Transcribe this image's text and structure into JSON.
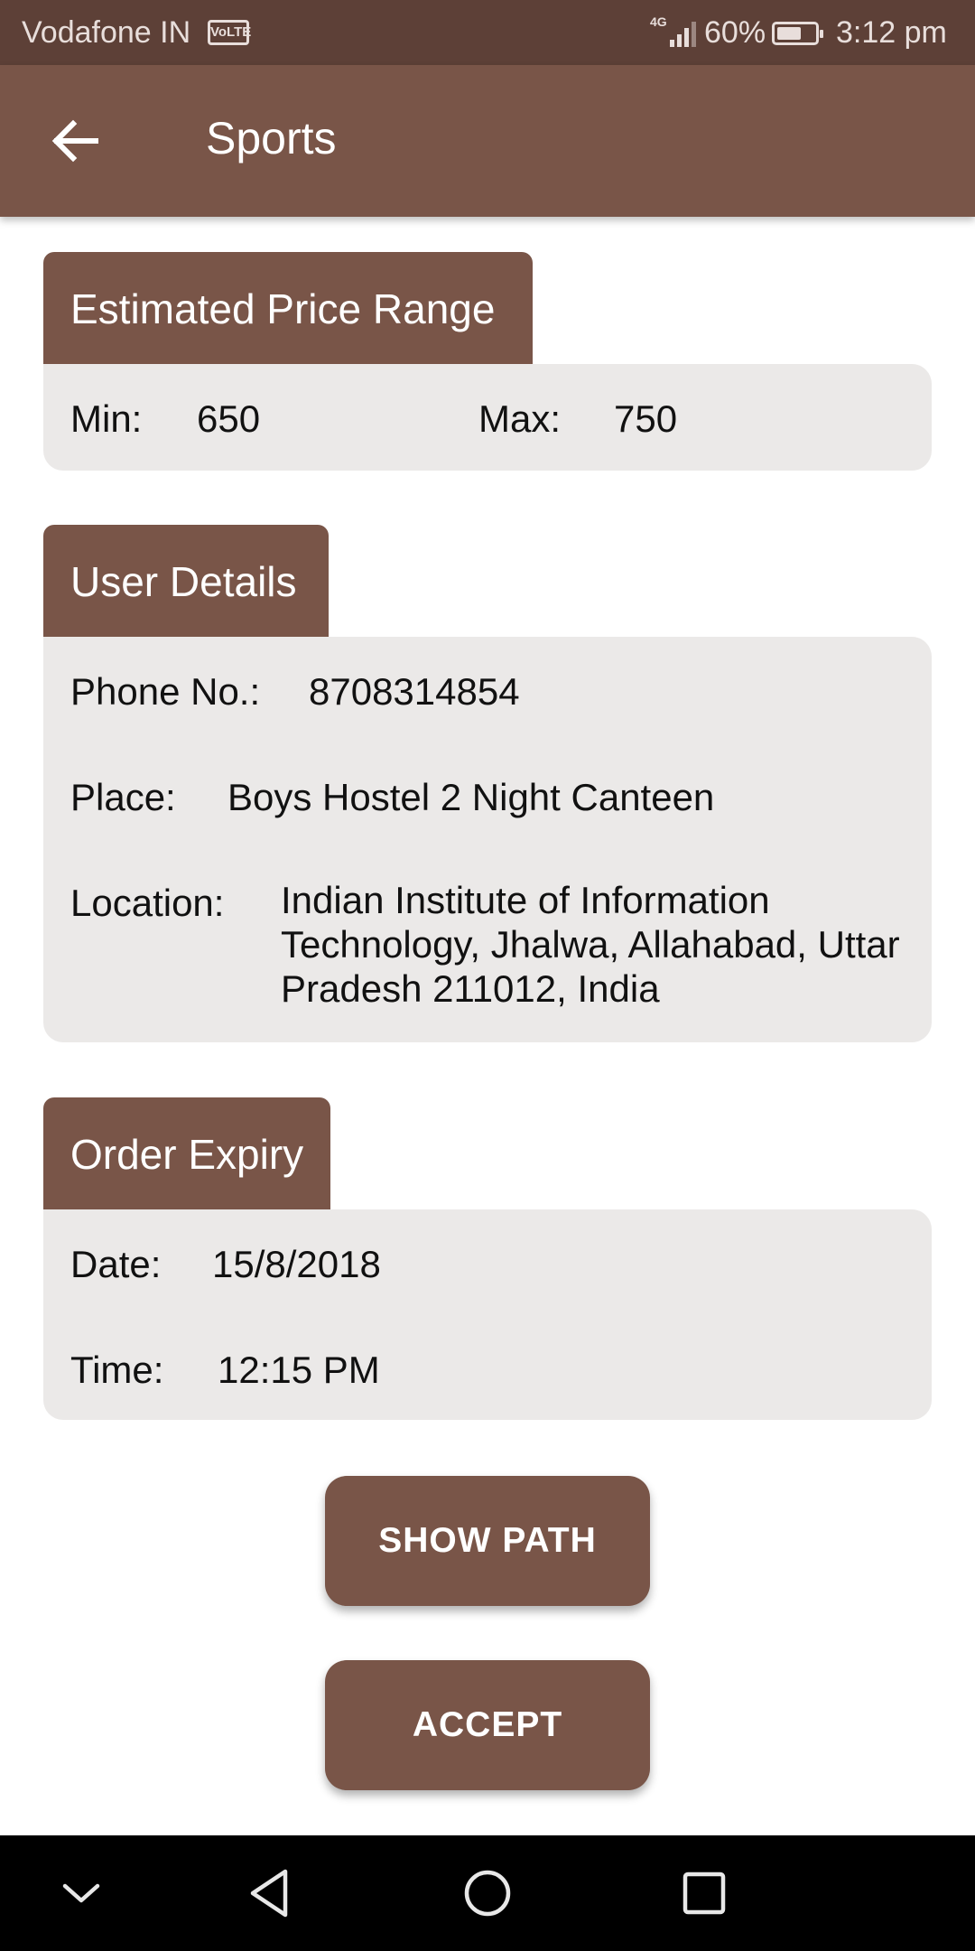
{
  "status_bar": {
    "carrier": "Vodafone IN",
    "volte_badge": "VoLTE",
    "network": "4G",
    "battery": "60%",
    "battery_level": 0.6,
    "time": "3:12 pm"
  },
  "app_bar": {
    "back_icon": "arrow-back-icon",
    "title": "Sports"
  },
  "price_range": {
    "header": "Estimated Price Range",
    "min_label": "Min:",
    "min_value": "650",
    "max_label": "Max:",
    "max_value": "750"
  },
  "user_details": {
    "header": "User Details",
    "phone_label": "Phone No.:",
    "phone_value": "8708314854",
    "place_label": "Place:",
    "place_value": "Boys Hostel 2 Night Canteen",
    "location_label": "Location:",
    "location_lines": [
      "Indian Institute of Information",
      "Technology, Jhalwa, Allahabad, Uttar",
      "Pradesh 211012, India"
    ]
  },
  "order_expiry": {
    "header": "Order Expiry",
    "date_label": "Date:",
    "date_value": "15/8/2018",
    "time_label": "Time:",
    "time_value": "12:15 PM"
  },
  "actions": {
    "show_path": "SHOW PATH",
    "accept": "ACCEPT"
  },
  "nav_bar": {
    "icons": [
      "chevron-down-icon",
      "back-triangle-icon",
      "home-circle-icon",
      "recents-square-icon"
    ]
  },
  "colors": {
    "status_bar": "#5d4037",
    "primary": "#795548",
    "card_bg": "#ebe9e8",
    "nav_bar": "#000000"
  }
}
